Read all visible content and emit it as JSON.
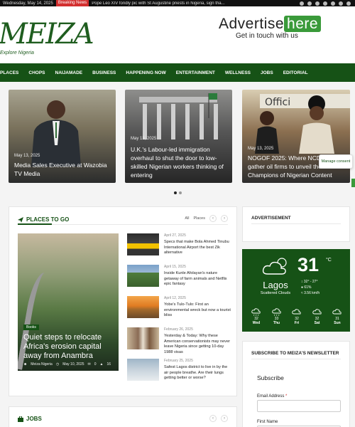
{
  "topbar": {
    "date": "Wednesday, May 14, 2025",
    "breaking_label": "Breaking News",
    "ticker": "Pope Leo XIV fondly pic with St Augustine priests in Nigeria, sign tha..."
  },
  "header": {
    "logo_text": "MEIZA",
    "logo_tagline": "Explore Nigeria",
    "ad_line1": "Advertise",
    "ad_highlight": "here",
    "ad_line2": "Get in touch with us"
  },
  "nav": {
    "items": [
      "PLACES",
      "CHOPS",
      "NAIJAMADE",
      "BUSINESS",
      "HAPPENING NOW",
      "ENTERTAINMENT",
      "WELLNESS",
      "JOBS",
      "EDITORIAL"
    ]
  },
  "slider": {
    "slides": [
      {
        "date": "May 13, 2025",
        "title": "Media Sales Executive at Wazobia TV Media"
      },
      {
        "date": "May 13, 2025",
        "title": "U.K.'s Labour-led immigration overhaul to shut the door to low-skilled Nigerian workers thinking of entering"
      },
      {
        "date": "May 13, 2025",
        "title": "NOGOF 2025: Where NCDMB gather oil firms to unveil the Champions of Nigerian Content"
      }
    ],
    "consent_label": "Manage consent"
  },
  "places": {
    "heading": "PLACES TO GO",
    "tab_all": "All",
    "tab_places": "Places",
    "feature": {
      "badge": "Books",
      "title": "Quiet steps to relocate Africa's erosion capital away from Anambra",
      "author": "Meiza Nigeria",
      "date": "May 10, 2025",
      "comments": "0",
      "likes": "16"
    },
    "list": [
      {
        "date": "April 27, 2025",
        "title": "Specs that make Bola Ahmed Tinubu International Airport the best Zik alternative"
      },
      {
        "date": "April 15, 2025",
        "title": "Inside Kunle Afolayan's nature getaway of farm animals and Netflix epic fantasy"
      },
      {
        "date": "April 12, 2025",
        "title": "Yobe's Tulo-Tulo: First an environmental wreck but now a tourist bliss"
      },
      {
        "date": "February 26, 2025",
        "title": "Yesterday & Today: Why these American conservationists may never leave Nigeria since getting 10-day 1988 visas"
      },
      {
        "date": "February 25, 2025",
        "title": "Safest Lagos district to live in by the air people breathe. Are their lungs getting better or worse?"
      }
    ]
  },
  "jobs": {
    "heading": "JOBS"
  },
  "sidebar": {
    "ad_heading": "ADVERTISEMENT",
    "weather": {
      "temp": "31",
      "unit": "°C",
      "city": "Lagos",
      "condition": "Scattered Clouds",
      "range": "32° - 27°",
      "humidity": "61%",
      "wind": "3.56 km/h",
      "forecast": [
        {
          "day": "Wed",
          "temp": "32"
        },
        {
          "day": "Thu",
          "temp": "33"
        },
        {
          "day": "Fri",
          "temp": "32"
        },
        {
          "day": "Sat",
          "temp": "32"
        },
        {
          "day": "Sun",
          "temp": "31"
        }
      ]
    },
    "newsletter_heading": "SUBSCRIBE TO MEIZA'S NEWSLETTER",
    "subscribe_label": "Subscribe",
    "email_label": "Email Address",
    "required_mark": "*",
    "first_name_label": "First Name"
  }
}
